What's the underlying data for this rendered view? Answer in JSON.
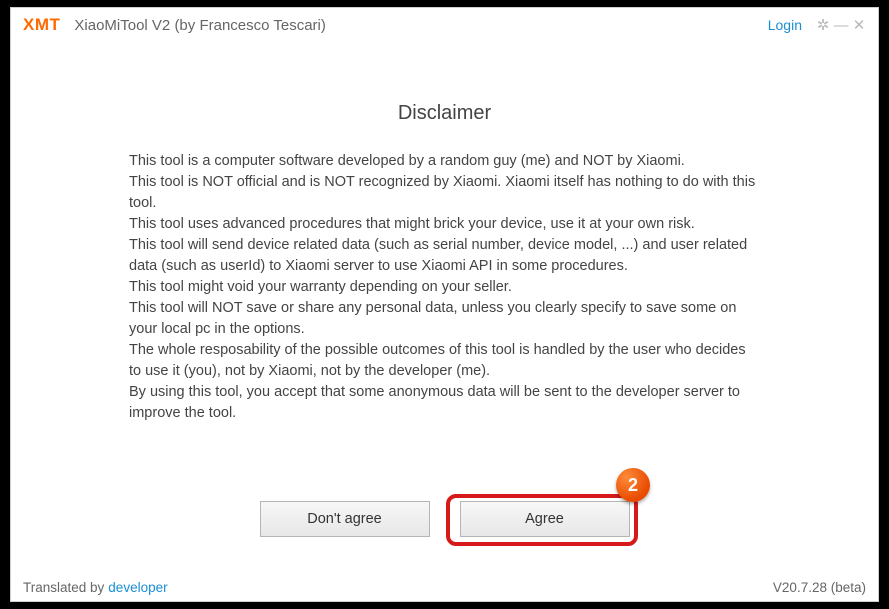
{
  "titlebar": {
    "logo": "XMT",
    "title": "XiaoMiTool V2 (by Francesco Tescari)",
    "login": "Login"
  },
  "disclaimer": {
    "heading": "Disclaimer",
    "body": "This tool is a computer software developed by a random guy (me) and NOT by Xiaomi.\nThis tool is NOT official and is NOT recognized by Xiaomi. Xiaomi itself has nothing to do with this tool.\nThis tool uses advanced procedures that might brick your device, use it at your own risk.\nThis tool will send device related data (such as serial number, device model, ...) and user related data (such as userId) to Xiaomi server to use Xiaomi API in some procedures.\nThis tool might void your warranty depending on your seller.\nThis tool will NOT save or share any personal data, unless you clearly specify to save some on your local pc in the options.\nThe whole resposability of the possible outcomes of this tool is handled by the user who decides to use it (you), not by Xiaomi, not by the developer (me).\nBy using this tool, you accept that some anonymous data will be sent to the developer server to improve the tool."
  },
  "buttons": {
    "dont_agree": "Don't agree",
    "agree": "Agree"
  },
  "footer": {
    "translated_by": "Translated by",
    "developer": "developer",
    "version": "V20.7.28 (beta)"
  },
  "annotation": {
    "badge": "2"
  }
}
